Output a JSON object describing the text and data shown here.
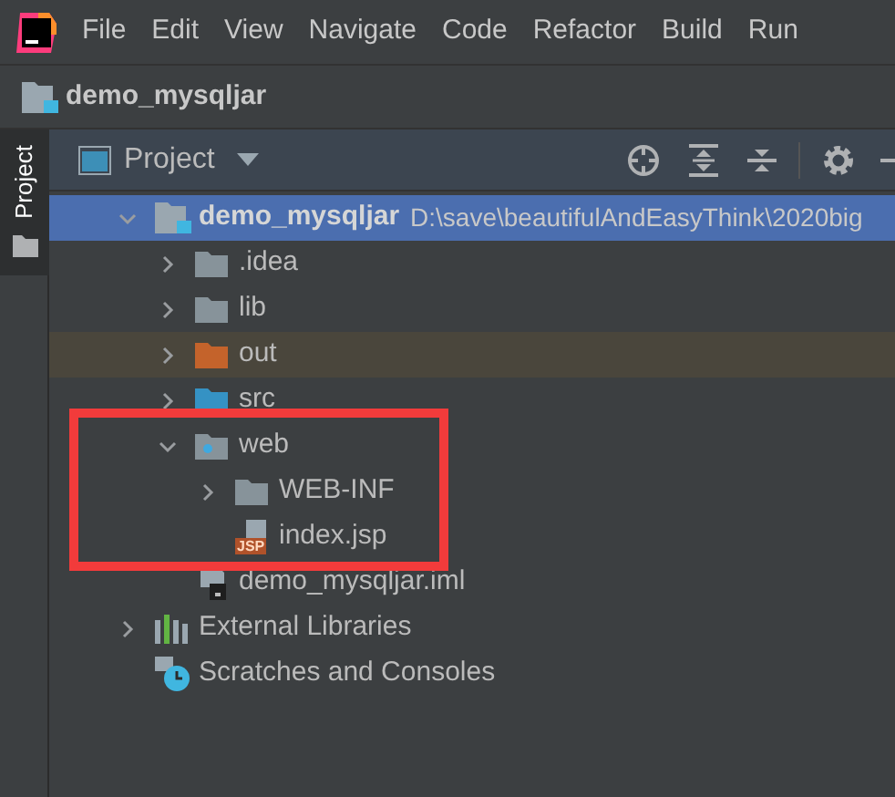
{
  "menu": [
    "File",
    "Edit",
    "View",
    "Navigate",
    "Code",
    "Refactor",
    "Build",
    "Run"
  ],
  "breadcrumb": {
    "label": "demo_mysqljar"
  },
  "tool_stripe": {
    "label": "Project",
    "selected": true
  },
  "panel": {
    "title": "Project"
  },
  "tree": [
    {
      "kind": "module",
      "label": "demo_mysqljar",
      "path": "D:\\save\\beautifulAndEasyThink\\2020big",
      "expanded": true,
      "selected": true,
      "children": [
        {
          "kind": "folder",
          "label": ".idea",
          "expanded": false,
          "selected": false
        },
        {
          "kind": "folder",
          "label": "lib",
          "expanded": false,
          "selected": false
        },
        {
          "kind": "excluded",
          "label": "out",
          "expanded": false,
          "selected": false
        },
        {
          "kind": "source",
          "label": "src",
          "expanded": false,
          "selected": false
        },
        {
          "kind": "web",
          "label": "web",
          "expanded": true,
          "selected": false,
          "children": [
            {
              "kind": "folder",
              "label": "WEB-INF",
              "expanded": false,
              "selected": false
            },
            {
              "kind": "jsp",
              "label": "index.jsp",
              "icon_label": "JSP",
              "selected": false
            }
          ]
        },
        {
          "kind": "iml",
          "label": "demo_mysqljar.iml",
          "selected": false
        }
      ]
    },
    {
      "kind": "libraries",
      "label": "External Libraries",
      "expanded": false,
      "selected": false
    },
    {
      "kind": "scratches",
      "label": "Scratches and Consoles",
      "selected": false
    }
  ]
}
